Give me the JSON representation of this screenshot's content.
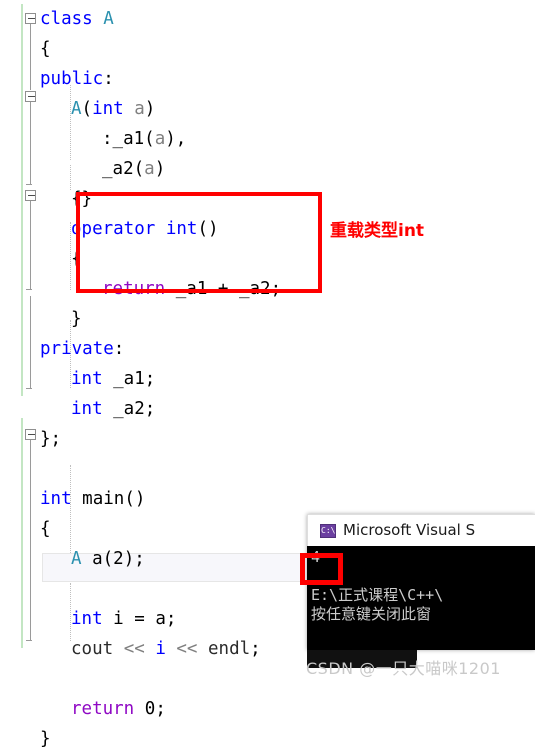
{
  "editor": {
    "name": "visual-studio-code-editor",
    "language": "C++",
    "code_lines": [
      {
        "indent": 0,
        "tokens": [
          {
            "t": "class ",
            "c": "kw"
          },
          {
            "t": "A",
            "c": "type"
          }
        ]
      },
      {
        "indent": 0,
        "tokens": [
          {
            "t": "{",
            "c": "punct"
          }
        ]
      },
      {
        "indent": 0,
        "tokens": [
          {
            "t": "public",
            "c": "kw"
          },
          {
            "t": ":",
            "c": "punct"
          }
        ]
      },
      {
        "indent": 1,
        "tokens": [
          {
            "t": "A",
            "c": "type"
          },
          {
            "t": "(",
            "c": "punct"
          },
          {
            "t": "int",
            "c": "kw"
          },
          {
            "t": " a",
            "c": "param"
          },
          {
            "t": ")",
            "c": "punct"
          }
        ]
      },
      {
        "indent": 2,
        "tokens": [
          {
            "t": ":_a1",
            "c": "ident"
          },
          {
            "t": "(",
            "c": "punct"
          },
          {
            "t": "a",
            "c": "param"
          },
          {
            "t": "),",
            "c": "punct"
          }
        ]
      },
      {
        "indent": 2,
        "tokens": [
          {
            "t": "_a2",
            "c": "ident"
          },
          {
            "t": "(",
            "c": "punct"
          },
          {
            "t": "a",
            "c": "param"
          },
          {
            "t": ")",
            "c": "punct"
          }
        ]
      },
      {
        "indent": 1,
        "tokens": [
          {
            "t": "{}",
            "c": "punct"
          }
        ]
      },
      {
        "indent": 1,
        "tokens": [
          {
            "t": "operator",
            "c": "kw"
          },
          {
            "t": " ",
            "c": "punct"
          },
          {
            "t": "int",
            "c": "kw"
          },
          {
            "t": "()",
            "c": "punct"
          }
        ]
      },
      {
        "indent": 1,
        "tokens": [
          {
            "t": "{",
            "c": "punct"
          }
        ]
      },
      {
        "indent": 2,
        "tokens": [
          {
            "t": "return",
            "c": "flow"
          },
          {
            "t": " _a1 + _a2;",
            "c": "ident"
          }
        ]
      },
      {
        "indent": 1,
        "tokens": [
          {
            "t": "}",
            "c": "punct"
          }
        ]
      },
      {
        "indent": 0,
        "tokens": [
          {
            "t": "private",
            "c": "kw"
          },
          {
            "t": ":",
            "c": "punct"
          }
        ]
      },
      {
        "indent": 1,
        "tokens": [
          {
            "t": "int",
            "c": "kw"
          },
          {
            "t": " _a1;",
            "c": "ident"
          }
        ]
      },
      {
        "indent": 1,
        "tokens": [
          {
            "t": "int",
            "c": "kw"
          },
          {
            "t": " _a2;",
            "c": "ident"
          }
        ]
      },
      {
        "indent": 0,
        "tokens": [
          {
            "t": "};",
            "c": "punct"
          }
        ]
      },
      {
        "indent": 0,
        "tokens": []
      },
      {
        "indent": 0,
        "tokens": [
          {
            "t": "int",
            "c": "kw"
          },
          {
            "t": " ",
            "c": "punct"
          },
          {
            "t": "main",
            "c": "ident"
          },
          {
            "t": "()",
            "c": "punct"
          }
        ]
      },
      {
        "indent": 0,
        "tokens": [
          {
            "t": "{",
            "c": "punct"
          }
        ]
      },
      {
        "indent": 1,
        "tokens": [
          {
            "t": "A",
            "c": "type"
          },
          {
            "t": " a",
            "c": "ident"
          },
          {
            "t": "(",
            "c": "punct"
          },
          {
            "t": "2",
            "c": "num"
          },
          {
            "t": ");",
            "c": "punct"
          }
        ]
      },
      {
        "indent": 0,
        "tokens": []
      },
      {
        "indent": 1,
        "tokens": [
          {
            "t": "int",
            "c": "kw"
          },
          {
            "t": " ",
            "c": "punct"
          },
          {
            "t": "i",
            "c": "ident"
          },
          {
            "t": " = ",
            "c": "punct"
          },
          {
            "t": "a",
            "c": "ident"
          },
          {
            "t": ";",
            "c": "punct"
          }
        ]
      },
      {
        "indent": 1,
        "tokens": [
          {
            "t": "cout",
            "c": "stream"
          },
          {
            "t": " << ",
            "c": "op"
          },
          {
            "t": "i",
            "c": "kw"
          },
          {
            "t": " << ",
            "c": "op"
          },
          {
            "t": "endl",
            "c": "stream"
          },
          {
            "t": ";",
            "c": "punct"
          }
        ]
      },
      {
        "indent": 0,
        "tokens": []
      },
      {
        "indent": 1,
        "tokens": [
          {
            "t": "return",
            "c": "flow"
          },
          {
            "t": " ",
            "c": "punct"
          },
          {
            "t": "0",
            "c": "num"
          },
          {
            "t": ";",
            "c": "punct"
          }
        ]
      },
      {
        "indent": 0,
        "tokens": [
          {
            "t": "}",
            "c": "punct"
          }
        ]
      }
    ],
    "plain_text_lines": [
      "class A",
      "{",
      "public:",
      "    A(int a)",
      "        :_a1(a),",
      "        _a2(a)",
      "    {}",
      "    operator int()",
      "    {",
      "        return _a1 + _a2;",
      "    }",
      "private:",
      "    int _a1;",
      "    int _a2;",
      "};",
      "",
      "int main()",
      "{",
      "    A a(2);",
      "",
      "    int i = a;",
      "    cout << i << endl;",
      "",
      "    return 0;",
      "}"
    ]
  },
  "annotation": {
    "label": "重载类型int",
    "color": "#ff0000"
  },
  "highlight_boxes": [
    {
      "name": "operator-int-highlight",
      "color": "#ff0000"
    },
    {
      "name": "console-output-highlight",
      "color": "#ff0000"
    }
  ],
  "console": {
    "title": "Microsoft Visual S",
    "icon": "console-window-icon",
    "icon_glyph": "C:\\",
    "output_lines": [
      "4",
      "",
      "E:\\正式课程\\C++\\",
      "按任意键关闭此窗"
    ]
  },
  "watermark": {
    "text": "CSDN @一只大喵咪1201"
  },
  "colors": {
    "keyword": "#0000ff",
    "type": "#2b91af",
    "control_flow": "#8f08c4",
    "parameter": "#808080",
    "identifier": "#000000",
    "operator": "#808080",
    "annotation": "#ff0000",
    "change_bar": "#c3e6c3",
    "console_bg": "#000000",
    "console_fg": "#cccccc"
  }
}
